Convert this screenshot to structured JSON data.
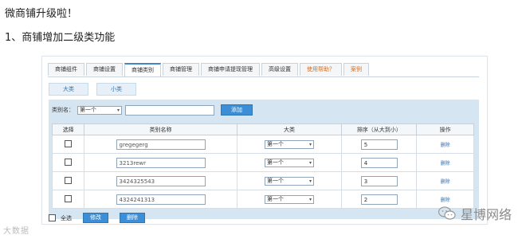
{
  "intro": {
    "line1": "微商铺升级啦！",
    "line2": "1、商铺增加二级类功能"
  },
  "tabs": [
    {
      "label": "商铺组件",
      "active": false,
      "highlight": false
    },
    {
      "label": "商铺设置",
      "active": false,
      "highlight": false
    },
    {
      "label": "商铺类别",
      "active": true,
      "highlight": false
    },
    {
      "label": "商铺管理",
      "active": false,
      "highlight": false
    },
    {
      "label": "商铺申请提现管理",
      "active": false,
      "highlight": false
    },
    {
      "label": "高级设置",
      "active": false,
      "highlight": false
    },
    {
      "label": "使用帮助？",
      "active": false,
      "highlight": true
    },
    {
      "label": "案例",
      "active": false,
      "highlight": true
    }
  ],
  "subtabs": [
    "大类",
    "小类"
  ],
  "filter": {
    "label": "类别名：",
    "select_value": "第一个",
    "add_button": "添加"
  },
  "table": {
    "headers": [
      "选择",
      "类别名称",
      "大类",
      "排序（从大到小）",
      "操作"
    ],
    "rows": [
      {
        "name": "gregegerg",
        "category": "第一个",
        "order": "5",
        "action": "删除"
      },
      {
        "name": "3213rewr",
        "category": "第一个",
        "order": "4",
        "action": "删除"
      },
      {
        "name": "3424325543",
        "category": "第一个",
        "order": "3",
        "action": "删除"
      },
      {
        "name": "4324241313",
        "category": "第一个",
        "order": "2",
        "action": "删除"
      }
    ]
  },
  "footer": {
    "select_all": "全选",
    "edit_button": "修改",
    "delete_button": "删除"
  },
  "watermarks": {
    "left": "大数据",
    "right": "星博网络"
  },
  "colors": {
    "accent": "#3c8fd6",
    "content_bg": "#d5e6f2",
    "highlight_tab": "#e06a16"
  }
}
